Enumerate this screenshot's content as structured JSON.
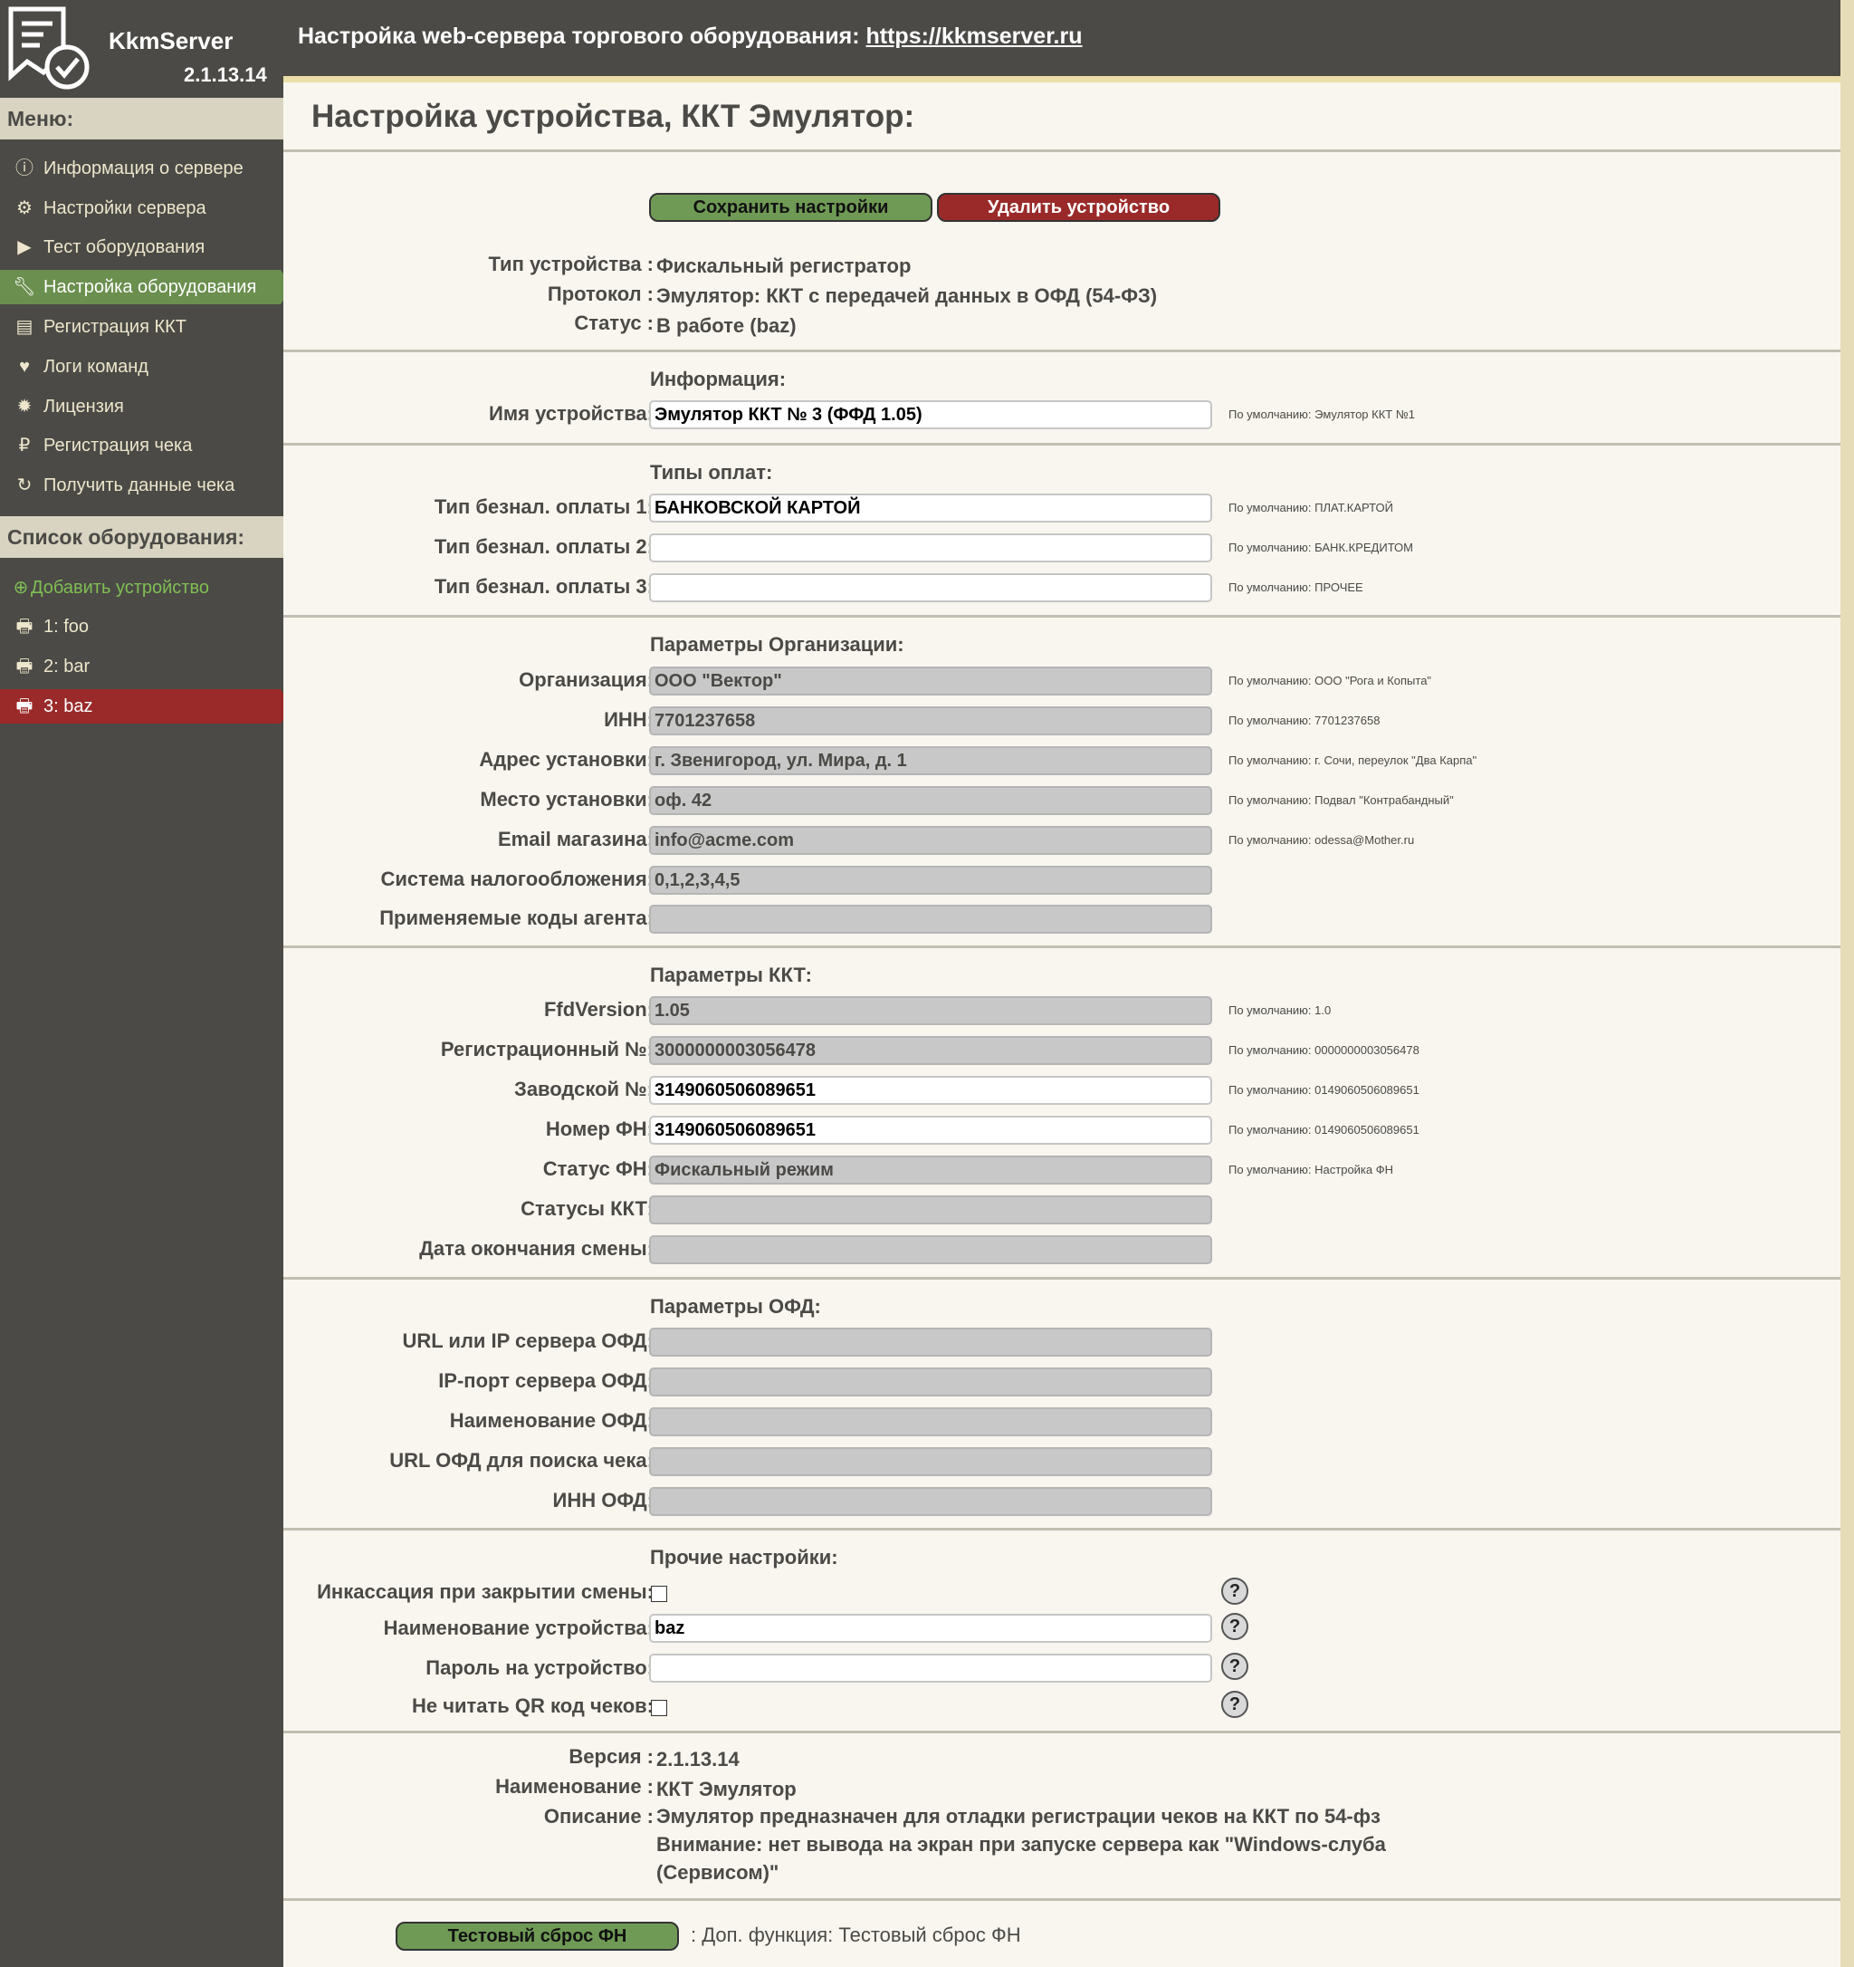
{
  "app": {
    "brand": "KkmServer",
    "version": "2.1.13.14"
  },
  "topbar": {
    "text": "Настройка web-сервера торгового оборудования: ",
    "link": "https://kkmserver.ru"
  },
  "menu": {
    "title": "Меню:",
    "items": [
      {
        "label": "Информация о сервере",
        "icon": "info-icon"
      },
      {
        "label": "Настройки сервера",
        "icon": "gears-icon"
      },
      {
        "label": "Тест оборудования",
        "icon": "play-icon"
      },
      {
        "label": "Настройка оборудования",
        "icon": "wrench-icon"
      },
      {
        "label": "Регистрация ККТ",
        "icon": "list-icon"
      },
      {
        "label": "Логи команд",
        "icon": "heartbeat-icon"
      },
      {
        "label": "Лицензия",
        "icon": "certificate-icon"
      },
      {
        "label": "Регистрация чека",
        "icon": "ruble-icon"
      },
      {
        "label": "Получить данные чека",
        "icon": "refresh-icon"
      }
    ]
  },
  "devices": {
    "title": "Список оборудования:",
    "add": "Добавить устройство",
    "items": [
      "1: foo",
      "2: bar",
      "3: baz"
    ]
  },
  "page": {
    "title": "Настройка устройства, ККТ Эмулятор:"
  },
  "buttons": {
    "save": "Сохранить настройки",
    "delete": "Удалить устройство",
    "reset": "Тестовый сброс ФН"
  },
  "summary": {
    "type_label": "Тип устройства :",
    "type": "Фискальный регистратор",
    "protocol_label": "Протокол :",
    "protocol": "Эмулятор: ККТ с передачей данных в ОФД (54-ФЗ)",
    "status_label": "Статус :",
    "status": "В работе (baz)"
  },
  "info": {
    "title": "Информация:",
    "name_label": "Имя устройства:",
    "name": "Эмулятор ККТ № 3 (ФФД 1.05)",
    "name_hint": "По умолчанию: Эмулятор ККТ №1"
  },
  "payments": {
    "title": "Типы оплат:",
    "rows": [
      {
        "label": "Тип безнал. оплаты 1:",
        "value": "БАНКОВСКОЙ КАРТОЙ",
        "hint": "По умолчанию: ПЛАТ.КАРТОЙ"
      },
      {
        "label": "Тип безнал. оплаты 2:",
        "value": "",
        "hint": "По умолчанию: БАНК.КРЕДИТОМ"
      },
      {
        "label": "Тип безнал. оплаты 3:",
        "value": "",
        "hint": "По умолчанию: ПРОЧЕЕ"
      }
    ]
  },
  "org": {
    "title": "Параметры Организации:",
    "rows": [
      {
        "label": "Организация:",
        "value": "ООО \"Вектор\"",
        "hint": "По умолчанию: ООО \"Рога и Копыта\""
      },
      {
        "label": "ИНН:",
        "value": "7701237658",
        "hint": "По умолчанию: 7701237658"
      },
      {
        "label": "Адрес установки:",
        "value": "г. Звенигород, ул. Мира, д. 1",
        "hint": "По умолчанию: г. Сочи, переулок \"Два Карпа\""
      },
      {
        "label": "Место установки:",
        "value": "оф. 42",
        "hint": "По умолчанию: Подвал \"Контрабандный\""
      },
      {
        "label": "Email магазина:",
        "value": "info@acme.com",
        "hint": "По умолчанию: odessa@Mother.ru"
      },
      {
        "label": "Система налогообложения:",
        "value": "0,1,2,3,4,5",
        "hint": ""
      },
      {
        "label": "Применяемые коды агента:",
        "value": "",
        "hint": ""
      }
    ]
  },
  "kkt": {
    "title": "Параметры ККТ:",
    "rows": [
      {
        "label": "FfdVersion:",
        "value": "1.05",
        "hint": "По умолчанию: 1.0",
        "editable": false
      },
      {
        "label": "Регистрационный №:",
        "value": "3000000003056478",
        "hint": "По умолчанию: 0000000003056478",
        "editable": false
      },
      {
        "label": "Заводской №:",
        "value": "3149060506089651",
        "hint": "По умолчанию: 0149060506089651",
        "editable": true
      },
      {
        "label": "Номер ФН:",
        "value": "3149060506089651",
        "hint": "По умолчанию: 0149060506089651",
        "editable": true
      },
      {
        "label": "Статус ФН:",
        "value": "Фискальный режим",
        "hint": "По умолчанию: Настройка ФН",
        "editable": false
      },
      {
        "label": "Статусы ККТ:",
        "value": "",
        "hint": "",
        "editable": false
      },
      {
        "label": "Дата окончания смены:",
        "value": "",
        "hint": "",
        "editable": false
      }
    ]
  },
  "ofd": {
    "title": "Параметры ОФД:",
    "rows": [
      {
        "label": "URL или IP сервера ОФД:",
        "value": ""
      },
      {
        "label": "IP-порт сервера ОФД:",
        "value": ""
      },
      {
        "label": "Наименование ОФД:",
        "value": ""
      },
      {
        "label": "URL ОФД для поиска чека:",
        "value": ""
      },
      {
        "label": "ИНН ОФД:",
        "value": ""
      }
    ]
  },
  "other": {
    "title": "Прочие настройки:",
    "incass_label": "Инкассация при закрытии смены:",
    "devname_label": "Наименование устройства:",
    "devname": "baz",
    "password_label": "Пароль на устройство:",
    "password": "",
    "noqr_label": "Не читать QR код чеков:",
    "help": "?"
  },
  "about": {
    "version_label": "Версия :",
    "version": "2.1.13.14",
    "name_label": "Наименование :",
    "name": "ККТ Эмулятор",
    "desc_label": "Описание :",
    "desc1": "Эмулятор предназначен для отладки регистрации чеков на ККТ по 54-фз",
    "desc2": "Внимание: нет вывода на экран при запуске сервера как \"Windows-слуба",
    "desc3": "(Сервисом)\""
  },
  "extra_fn": ": Доп. функция: Тестовый сброс ФН",
  "colors": {
    "sidebar": "#4b4a46",
    "active": "#6a8f4e",
    "danger": "#9a2a2a",
    "section": "#d9d3c1",
    "page": "#f8f6ef"
  }
}
